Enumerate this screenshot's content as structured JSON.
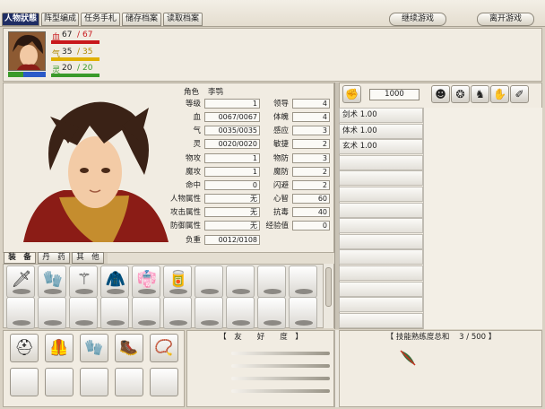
{
  "menu": {
    "tabs": [
      "人物狀態",
      "阵型编成",
      "任务手札",
      "储存档案",
      "读取档案"
    ],
    "continue_label": "继续游戏",
    "exit_label": "离开游戏"
  },
  "portrait_stats": {
    "hp_label": "血",
    "hp_cur": "67",
    "hp_max": "67",
    "qi_label": "气",
    "qi_cur": "35",
    "qi_max": "35",
    "ling_label": "灵",
    "ling_cur": "20",
    "ling_max": "20",
    "colors": {
      "hp": "#c8181c",
      "qi": "#e0b000",
      "ling": "#3a9a2a"
    }
  },
  "character": {
    "role_label": "角色",
    "role_name": "李鹗",
    "left_stats": [
      {
        "label": "等级",
        "value": "1"
      },
      {
        "label": "血",
        "value": "0067/0067"
      },
      {
        "label": "气",
        "value": "0035/0035"
      },
      {
        "label": "灵",
        "value": "0020/0020"
      },
      {
        "label": "物攻",
        "value": "1"
      },
      {
        "label": "魔攻",
        "value": "1"
      },
      {
        "label": "命中",
        "value": "0"
      },
      {
        "label": "人物属性",
        "value": "无"
      },
      {
        "label": "攻击属性",
        "value": "无"
      },
      {
        "label": "防御属性",
        "value": "无"
      },
      {
        "label": "负重",
        "value": "0012/0108"
      }
    ],
    "right_stats": [
      {
        "label": "领导",
        "value": "4"
      },
      {
        "label": "体魄",
        "value": "4"
      },
      {
        "label": "感应",
        "value": "3"
      },
      {
        "label": "敏捷",
        "value": "2"
      },
      {
        "label": "物防",
        "value": "3"
      },
      {
        "label": "魔防",
        "value": "2"
      },
      {
        "label": "闪避",
        "value": "2"
      },
      {
        "label": "心智",
        "value": "60"
      },
      {
        "label": "抗毒",
        "value": "40"
      },
      {
        "label": "经验值",
        "value": "0"
      }
    ]
  },
  "money": "1000",
  "skills": [
    {
      "name": "剑术 1.00"
    },
    {
      "name": "体术 1.00"
    },
    {
      "name": "玄术 1.00"
    },
    {
      "name": ""
    },
    {
      "name": ""
    },
    {
      "name": ""
    },
    {
      "name": ""
    },
    {
      "name": ""
    },
    {
      "name": ""
    },
    {
      "name": ""
    },
    {
      "name": ""
    },
    {
      "name": ""
    },
    {
      "name": ""
    },
    {
      "name": ""
    }
  ],
  "inventory_tabs": [
    "装　备",
    "丹　药",
    "其　他"
  ],
  "inventory_items": [
    {
      "icon": "sword-icon",
      "glyph": "🗡"
    },
    {
      "icon": "glove-icon",
      "glyph": "🧤"
    },
    {
      "icon": "staff-icon",
      "glyph": "⚚"
    },
    {
      "icon": "cape-icon",
      "glyph": "🧥"
    },
    {
      "icon": "robe-icon",
      "glyph": "👘"
    },
    {
      "icon": "bracer-icon",
      "glyph": "🥫"
    }
  ],
  "equipment_icons": [
    "helmet-icon",
    "armor-icon",
    "glove-icon",
    "boots-icon",
    "necklace-icon"
  ],
  "friendship": {
    "title": "【　友　　好　　度　】"
  },
  "skill_total": {
    "title": "【 技能熟练度总和",
    "current": "3",
    "max": "/ 500",
    "close": "】"
  }
}
